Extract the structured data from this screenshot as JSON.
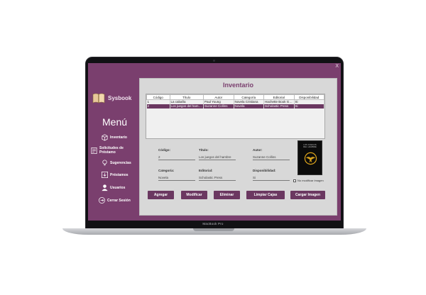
{
  "device": {
    "model": "MacBook Pro"
  },
  "window": {
    "close_label": "X"
  },
  "brand": {
    "name": "Sysbook"
  },
  "menu": {
    "title": "Menú",
    "items": [
      {
        "label": "Inventario",
        "icon": "package-icon"
      },
      {
        "label": "Solicitudes de Préstamo",
        "icon": "request-form-icon"
      },
      {
        "label": "Sugerencias",
        "icon": "lightbulb-icon"
      },
      {
        "label": "Préstamos",
        "icon": "download-icon"
      },
      {
        "label": "Usuarios",
        "icon": "user-icon"
      },
      {
        "label": "Cerrar Sesión",
        "icon": "logout-icon"
      }
    ]
  },
  "panel": {
    "title": "Inventario"
  },
  "table": {
    "columns": [
      "Código",
      "Título",
      "Autor",
      "Categoría",
      "Editorial",
      "Disponibilidad"
    ],
    "rows": [
      [
        "1",
        "La cabaña",
        "Paul Young",
        "Novela Cristiana",
        "Hachette Book Grou...",
        "Si"
      ],
      [
        "2",
        "Los juegos del hambre",
        "Suzanne Collins",
        "Novela",
        "Scholastic Press",
        "Si"
      ]
    ],
    "selected_row": 1
  },
  "form": {
    "codigo": {
      "label": "Código:",
      "value": "2"
    },
    "titulo": {
      "label": "Título:",
      "value": "Los juegos del hambre"
    },
    "autor": {
      "label": "Autor:",
      "value": "Suzanne Collins"
    },
    "categoria": {
      "label": "Categoría:",
      "value": "Novela"
    },
    "editorial": {
      "label": "Editorial:",
      "value": "Scholastic Press"
    },
    "disponibilidad": {
      "label": "Disponibilidad:",
      "value": "Si"
    }
  },
  "cover": {
    "title_line1": "LOS JUEGOS",
    "title_line2": "DEL HAMBRE"
  },
  "no_modify_label": "No modificar imagen",
  "buttons": {
    "agregar": "Agregar",
    "modificar": "Modificar",
    "eliminar": "Eliminar",
    "limpiar": "Limpiar Cajas",
    "cargar": "Cargar Imagen"
  },
  "colors": {
    "accent": "#7a3f6e",
    "button": "#6b3861",
    "panel": "#d8d8d8"
  }
}
